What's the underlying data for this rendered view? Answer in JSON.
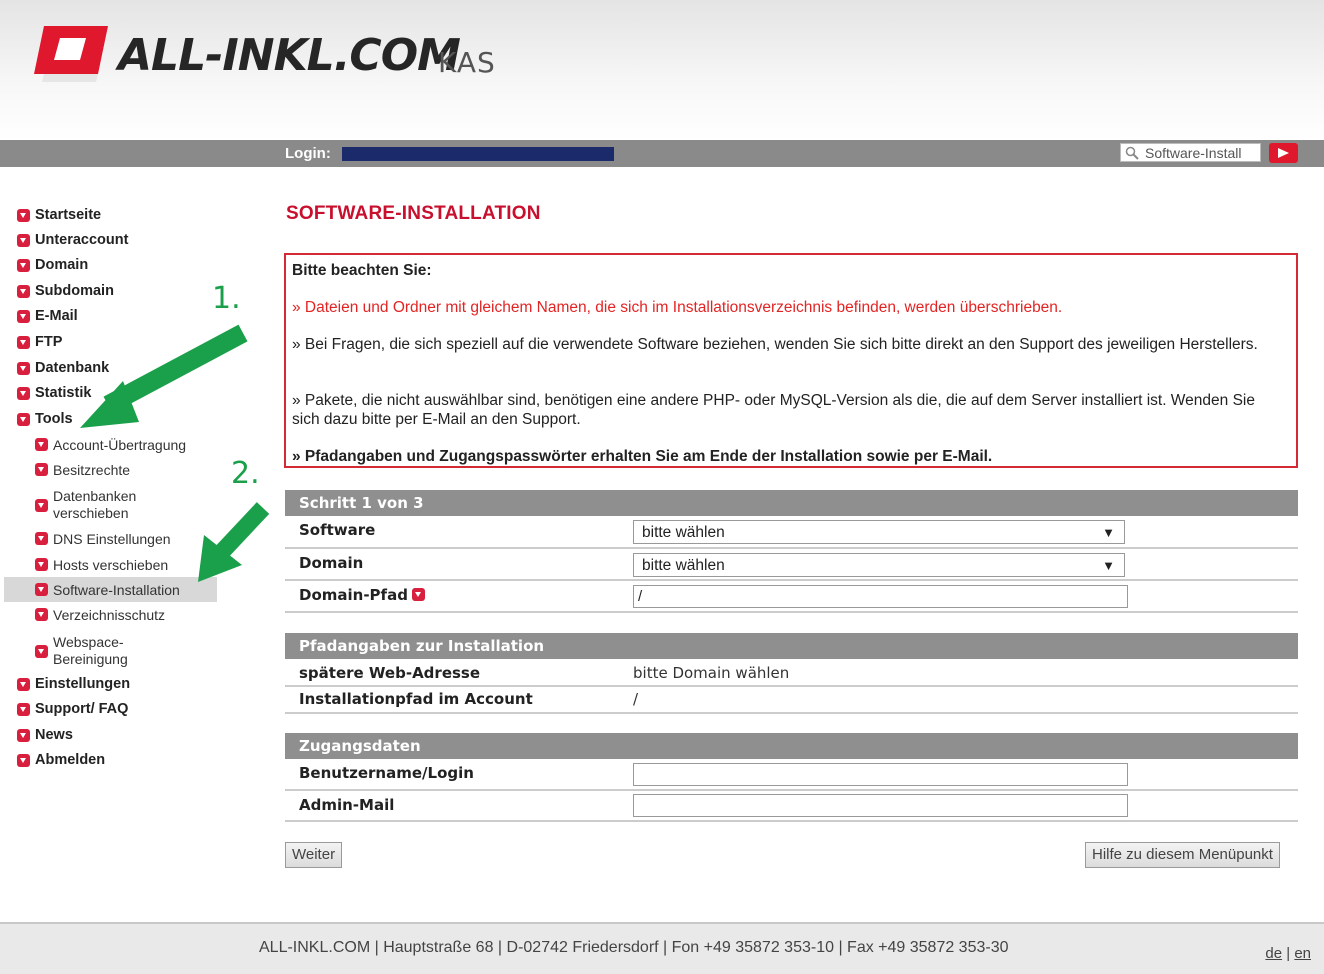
{
  "header": {
    "brand": "ALL-INKL.COM",
    "product": "KAS",
    "logo_color": "#e0182e"
  },
  "loginbar": {
    "label": "Login:",
    "search_placeholder": "Software-Install",
    "go_icon": "play-arrow-icon"
  },
  "sidebar": {
    "items": [
      {
        "label": "Startseite"
      },
      {
        "label": "Unteraccount"
      },
      {
        "label": "Domain"
      },
      {
        "label": "Subdomain"
      },
      {
        "label": "E-Mail"
      },
      {
        "label": "FTP"
      },
      {
        "label": "Datenbank"
      },
      {
        "label": "Statistik"
      },
      {
        "label": "Tools"
      },
      {
        "label": "Einstellungen"
      },
      {
        "label": "Support/ FAQ"
      },
      {
        "label": "News"
      },
      {
        "label": "Abmelden"
      }
    ],
    "tools_sub": [
      {
        "label": "Account-Übertragung"
      },
      {
        "label": "Besitzrechte"
      },
      {
        "label": "Datenbanken verschieben"
      },
      {
        "label": "DNS Einstellungen"
      },
      {
        "label": "Hosts verschieben"
      },
      {
        "label": "Software-Installation"
      },
      {
        "label": "Verzeichnisschutz"
      },
      {
        "label": "Webspace-Bereinigung"
      }
    ],
    "active": "Software-Installation"
  },
  "annotations": {
    "step1": "1.",
    "step2": "2.",
    "arrow_color": "#1aa04a"
  },
  "main": {
    "title": "SOFTWARE-INSTALLATION",
    "notice": {
      "heading": "Bitte beachten Sie:",
      "warning": "» Dateien und Ordner mit gleichem Namen, die sich im Installationsverzeichnis befinden, werden überschrieben.",
      "line1": "» Bei Fragen, die sich speziell auf die verwendete Software beziehen, wenden Sie sich bitte direkt an den Support des jeweiligen Herstellers.",
      "line2": "» Pakete, die nicht auswählbar sind, benötigen eine andere PHP- oder MySQL-Version als die, die auf dem Server installiert ist. Wenden Sie sich dazu bitte per E-Mail an den Support.",
      "bold": "» Pfadangaben und Zugangspasswörter erhalten Sie am Ende der Installation sowie per E-Mail."
    },
    "step": {
      "title": "Schritt 1 von 3",
      "software_label": "Software",
      "software_value": "bitte wählen",
      "domain_label": "Domain",
      "domain_value": "bitte wählen",
      "path_label": "Domain-Pfad",
      "path_value": "/"
    },
    "paths": {
      "title": "Pfadangaben zur Installation",
      "web_label": "spätere Web-Adresse",
      "web_value": "bitte Domain wählen",
      "install_label": "Installationpfad im Account",
      "install_value": "/"
    },
    "credentials": {
      "title": "Zugangsdaten",
      "user_label": "Benutzername/Login",
      "user_value": "",
      "mail_label": "Admin-Mail",
      "mail_value": ""
    },
    "buttons": {
      "next": "Weiter",
      "help": "Hilfe zu diesem Menüpunkt"
    }
  },
  "footer": {
    "address": "ALL-INKL.COM | Hauptstraße 68 | D-02742 Friedersdorf | Fon +49 35872 353-10 | Fax +49 35872 353-30",
    "lang_de": "de",
    "lang_sep": "|",
    "lang_en": "en"
  }
}
